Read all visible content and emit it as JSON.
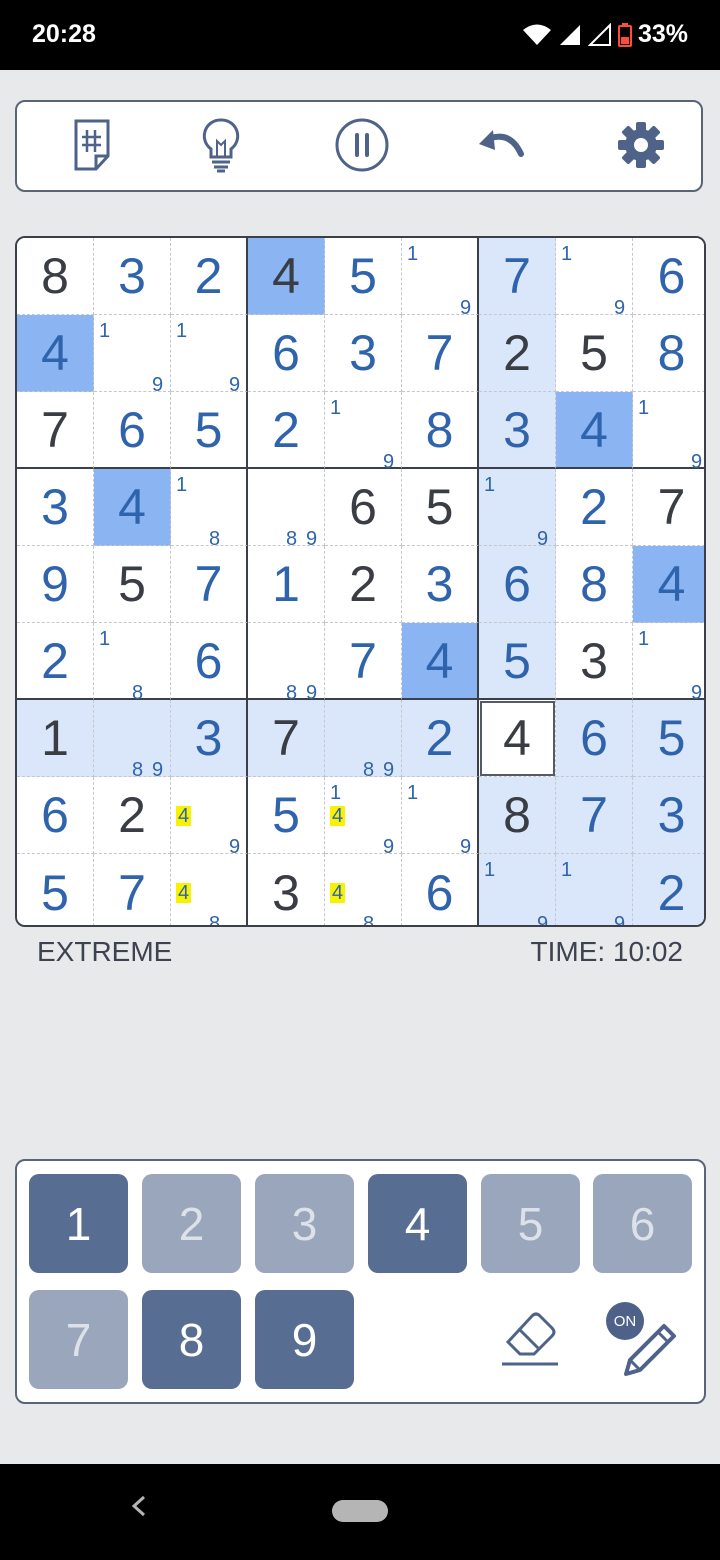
{
  "status": {
    "time": "20:28",
    "battery": "33%"
  },
  "toolbar": {
    "icons": [
      "notes-grid-icon",
      "hint-lightbulb-icon",
      "pause-icon",
      "undo-icon",
      "settings-gear-icon"
    ]
  },
  "board": {
    "cells": [
      [
        {
          "v": "8",
          "g": 1
        },
        {
          "v": "3"
        },
        {
          "v": "2"
        },
        {
          "v": "4",
          "g": 1,
          "sel": 1
        },
        {
          "v": "5"
        },
        {
          "n": [
            "1",
            "9"
          ]
        },
        {
          "v": "7",
          "h": 1
        },
        {
          "n": [
            "1",
            "9"
          ]
        },
        {
          "v": "6"
        }
      ],
      [
        {
          "v": "4",
          "sel": 1
        },
        {
          "n": [
            "1",
            "9"
          ]
        },
        {
          "n": [
            "1",
            "9"
          ]
        },
        {
          "v": "6"
        },
        {
          "v": "3"
        },
        {
          "v": "7"
        },
        {
          "v": "2",
          "g": 1,
          "h": 1
        },
        {
          "v": "5",
          "g": 1
        },
        {
          "v": "8"
        }
      ],
      [
        {
          "v": "7",
          "g": 1
        },
        {
          "v": "6"
        },
        {
          "v": "5"
        },
        {
          "v": "2"
        },
        {
          "n": [
            "1",
            "9"
          ]
        },
        {
          "v": "8"
        },
        {
          "v": "3",
          "h": 1
        },
        {
          "v": "4",
          "sel": 1
        },
        {
          "n": [
            "1",
            "9"
          ]
        }
      ],
      [
        {
          "v": "3"
        },
        {
          "v": "4",
          "sel": 1
        },
        {
          "n": [
            "1",
            "8"
          ]
        },
        {
          "n": [
            "8",
            "9"
          ]
        },
        {
          "v": "6",
          "g": 1
        },
        {
          "v": "5",
          "g": 1
        },
        {
          "n": [
            "1",
            "9"
          ],
          "h": 1
        },
        {
          "v": "2"
        },
        {
          "v": "7",
          "g": 1
        }
      ],
      [
        {
          "v": "9"
        },
        {
          "v": "5",
          "g": 1
        },
        {
          "v": "7"
        },
        {
          "v": "1"
        },
        {
          "v": "2",
          "g": 1
        },
        {
          "v": "3"
        },
        {
          "v": "6",
          "h": 1
        },
        {
          "v": "8"
        },
        {
          "v": "4",
          "sel": 1
        }
      ],
      [
        {
          "v": "2"
        },
        {
          "n": [
            "1",
            "8"
          ]
        },
        {
          "v": "6"
        },
        {
          "n": [
            "8",
            "9"
          ]
        },
        {
          "v": "7"
        },
        {
          "v": "4",
          "sel": 1
        },
        {
          "v": "5",
          "h": 1
        },
        {
          "v": "3",
          "g": 1
        },
        {
          "n": [
            "1",
            "9"
          ]
        }
      ],
      [
        {
          "v": "1",
          "g": 1,
          "h": 1
        },
        {
          "n": [
            "8",
            "9"
          ],
          "h": 1
        },
        {
          "v": "3",
          "h": 1
        },
        {
          "v": "7",
          "g": 1,
          "h": 1
        },
        {
          "n": [
            "8",
            "9"
          ],
          "h": 1
        },
        {
          "v": "2",
          "h": 1
        },
        {
          "v": "4",
          "g": 1,
          "cur": 1
        },
        {
          "v": "6",
          "h": 1
        },
        {
          "v": "5",
          "h": 1
        }
      ],
      [
        {
          "v": "6"
        },
        {
          "v": "2",
          "g": 1
        },
        {
          "n": [
            "4",
            "9"
          ],
          "y": "4"
        },
        {
          "v": "5"
        },
        {
          "n": [
            "1",
            "4",
            "9"
          ],
          "y": "4"
        },
        {
          "n": [
            "1",
            "9"
          ]
        },
        {
          "v": "8",
          "g": 1,
          "h": 1
        },
        {
          "v": "7",
          "h": 1
        },
        {
          "v": "3",
          "h": 1
        }
      ],
      [
        {
          "v": "5"
        },
        {
          "v": "7"
        },
        {
          "n": [
            "4",
            "8"
          ],
          "y": "4"
        },
        {
          "v": "3",
          "g": 1
        },
        {
          "n": [
            "4",
            "8"
          ],
          "y": "4"
        },
        {
          "v": "6"
        },
        {
          "n": [
            "1",
            "9"
          ],
          "h": 1
        },
        {
          "n": [
            "1",
            "9"
          ],
          "h": 1
        },
        {
          "v": "2",
          "h": 1
        }
      ]
    ]
  },
  "game": {
    "difficulty": "EXTREME",
    "timer": "TIME: 10:02"
  },
  "keypad": {
    "keys": [
      {
        "label": "1",
        "enabled": true
      },
      {
        "label": "2",
        "enabled": false
      },
      {
        "label": "3",
        "enabled": false
      },
      {
        "label": "4",
        "enabled": true
      },
      {
        "label": "5",
        "enabled": false
      },
      {
        "label": "6",
        "enabled": false
      },
      {
        "label": "7",
        "enabled": false
      },
      {
        "label": "8",
        "enabled": true
      },
      {
        "label": "9",
        "enabled": true
      }
    ],
    "pencil_badge": "ON"
  },
  "colors": {
    "given": "#3a3d44",
    "entered": "#2f64ad",
    "highlight": "#dae7fa",
    "selected": "#8ab4f2",
    "note_highlight": "#f7f300"
  }
}
